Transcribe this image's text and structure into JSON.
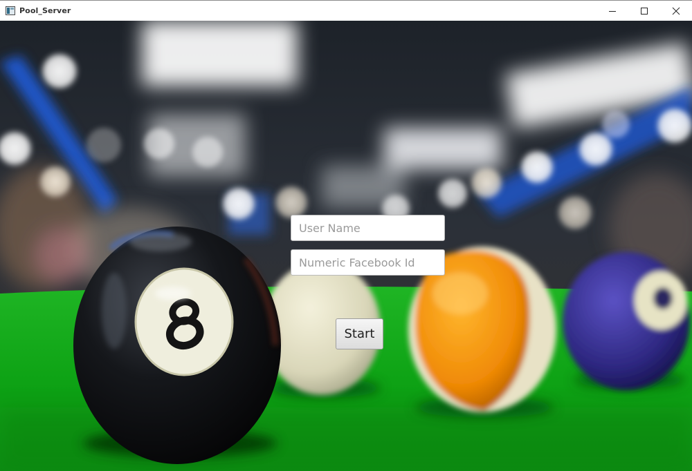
{
  "window": {
    "title": "Pool_Server",
    "controls": [
      "minimize",
      "maximize",
      "close"
    ]
  },
  "form": {
    "username_placeholder": "User Name",
    "username_value": "",
    "facebook_id_placeholder": "Numeric Facebook Id",
    "facebook_id_value": "",
    "start_label": "Start"
  },
  "background": {
    "description_icon": "billiard-balls-photo",
    "table_color": "#0fa51a"
  }
}
